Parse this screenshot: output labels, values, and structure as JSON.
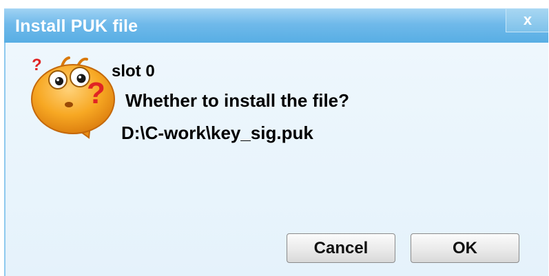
{
  "window": {
    "title": "Install PUK file",
    "close_glyph": "x"
  },
  "message": {
    "slot": "slot 0",
    "question": "Whether to install the file?",
    "file_path": "D:\\C-work\\key_sig.puk"
  },
  "buttons": {
    "cancel": "Cancel",
    "ok": "OK"
  },
  "icons": {
    "mascot": "question-mascot-icon",
    "close": "close-icon"
  },
  "colors": {
    "titlebar": "#6fb9ea",
    "content_bg": "#e8f4fc",
    "mascot_orange": "#f5a623",
    "question_mark": "#e02424"
  }
}
